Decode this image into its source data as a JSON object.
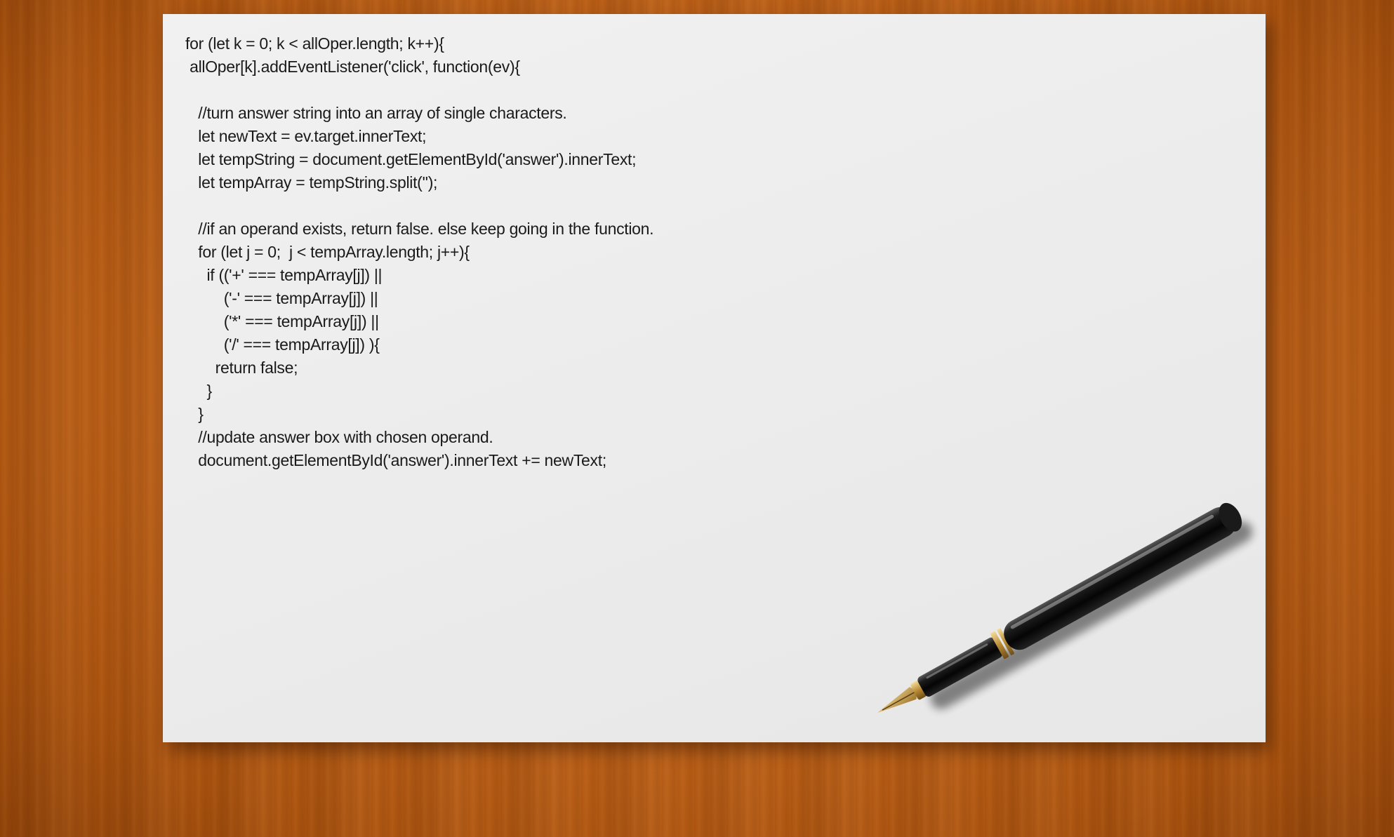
{
  "code": {
    "lines": [
      "for (let k = 0; k < allOper.length; k++){",
      " allOper[k].addEventListener('click', function(ev){",
      "",
      "   //turn answer string into an array of single characters.",
      "   let newText = ev.target.innerText;",
      "   let tempString = document.getElementById('answer').innerText;",
      "   let tempArray = tempString.split('');",
      "",
      "   //if an operand exists, return false. else keep going in the function.",
      "   for (let j = 0;  j < tempArray.length; j++){",
      "     if (('+' === tempArray[j]) ||",
      "         ('-' === tempArray[j]) ||",
      "         ('*' === tempArray[j]) ||",
      "         ('/' === tempArray[j]) ){",
      "       return false;",
      "     }",
      "   }",
      "   //update answer box with chosen operand.",
      "   document.getElementById('answer').innerText += newText;"
    ]
  },
  "colors": {
    "desk": "#c2651c",
    "paper": "#eeeeee",
    "ink": "#1a1a1a",
    "pen_body": "#111111",
    "pen_gold": "#c9a04a"
  },
  "decor": {
    "pen": "fountain-pen-icon"
  }
}
